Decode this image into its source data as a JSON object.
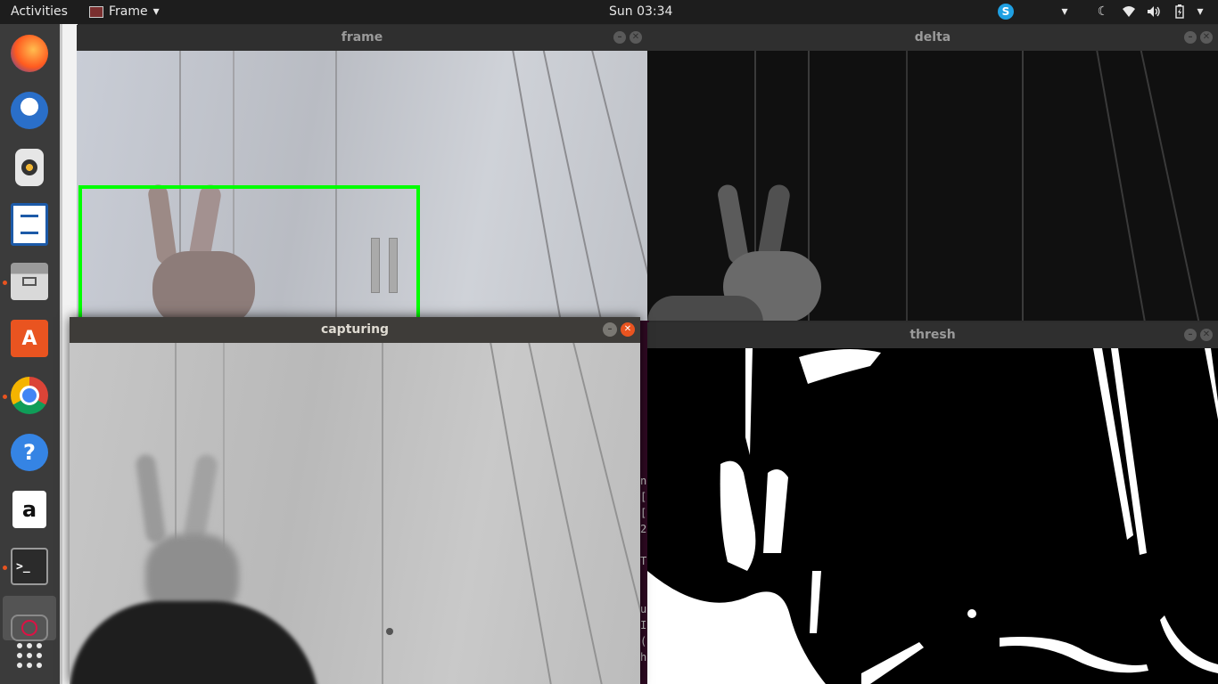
{
  "topbar": {
    "activities": "Activities",
    "app_name": "Frame",
    "clock": "Sun 03:34"
  },
  "dock": {
    "items": [
      "firefox",
      "thunderbird",
      "rhythmbox",
      "libreoffice-writer",
      "files",
      "ubuntu-software",
      "chrome",
      "help",
      "amazon",
      "terminal",
      "camera-app",
      "show-applications"
    ]
  },
  "windows": {
    "frame": {
      "title": "frame"
    },
    "delta": {
      "title": "delta"
    },
    "thresh": {
      "title": "thresh"
    },
    "capturing": {
      "title": "capturing"
    }
  },
  "terminal_fragment": {
    "lines": [
      "n",
      "[",
      "[",
      "2",
      "T",
      "u",
      "I",
      "(",
      "h"
    ]
  },
  "colors": {
    "detection_box": "#00ff00",
    "accent": "#e95420",
    "terminal_bg": "#300a24"
  }
}
